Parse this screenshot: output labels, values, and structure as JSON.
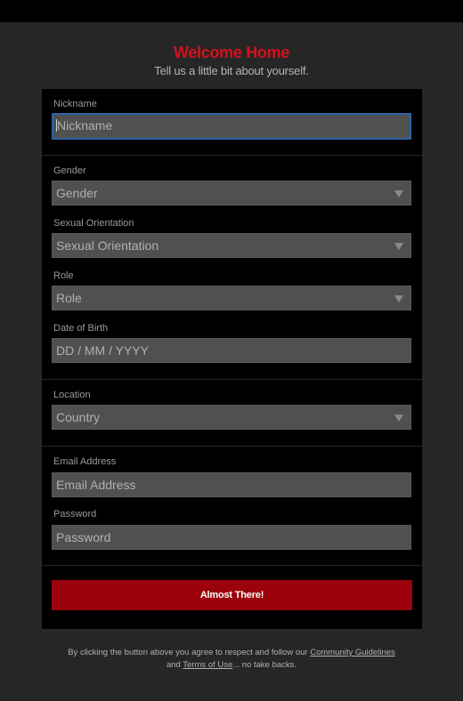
{
  "header": {
    "title": "Welcome Home",
    "subtitle": "Tell us a little bit about yourself."
  },
  "colors": {
    "title": "#d3121c",
    "submit_bg": "#9b020c",
    "focus_border": "#2f62a8",
    "page_bg": "#262626",
    "panel_bg": "#000000",
    "field_bg": "#505050"
  },
  "form": {
    "nickname": {
      "label": "Nickname",
      "placeholder": "Nickname",
      "value": ""
    },
    "gender": {
      "label": "Gender",
      "selected": "Gender"
    },
    "orientation": {
      "label": "Sexual Orientation",
      "selected": "Sexual Orientation"
    },
    "role": {
      "label": "Role",
      "selected": "Role"
    },
    "dob": {
      "label": "Date of Birth",
      "placeholder": "DD / MM / YYYY",
      "value": ""
    },
    "location": {
      "label": "Location",
      "selected": "Country"
    },
    "email": {
      "label": "Email Address",
      "placeholder": "Email Address",
      "value": ""
    },
    "password": {
      "label": "Password",
      "placeholder": "Password",
      "value": ""
    },
    "submit_label": "Almost There!"
  },
  "footer": {
    "text_before": "By clicking the button above you agree to respect and follow our ",
    "link_guidelines": "Community Guidelines",
    "text_and": "and ",
    "link_terms": "Terms of Use",
    "text_after": "... no take backs."
  }
}
